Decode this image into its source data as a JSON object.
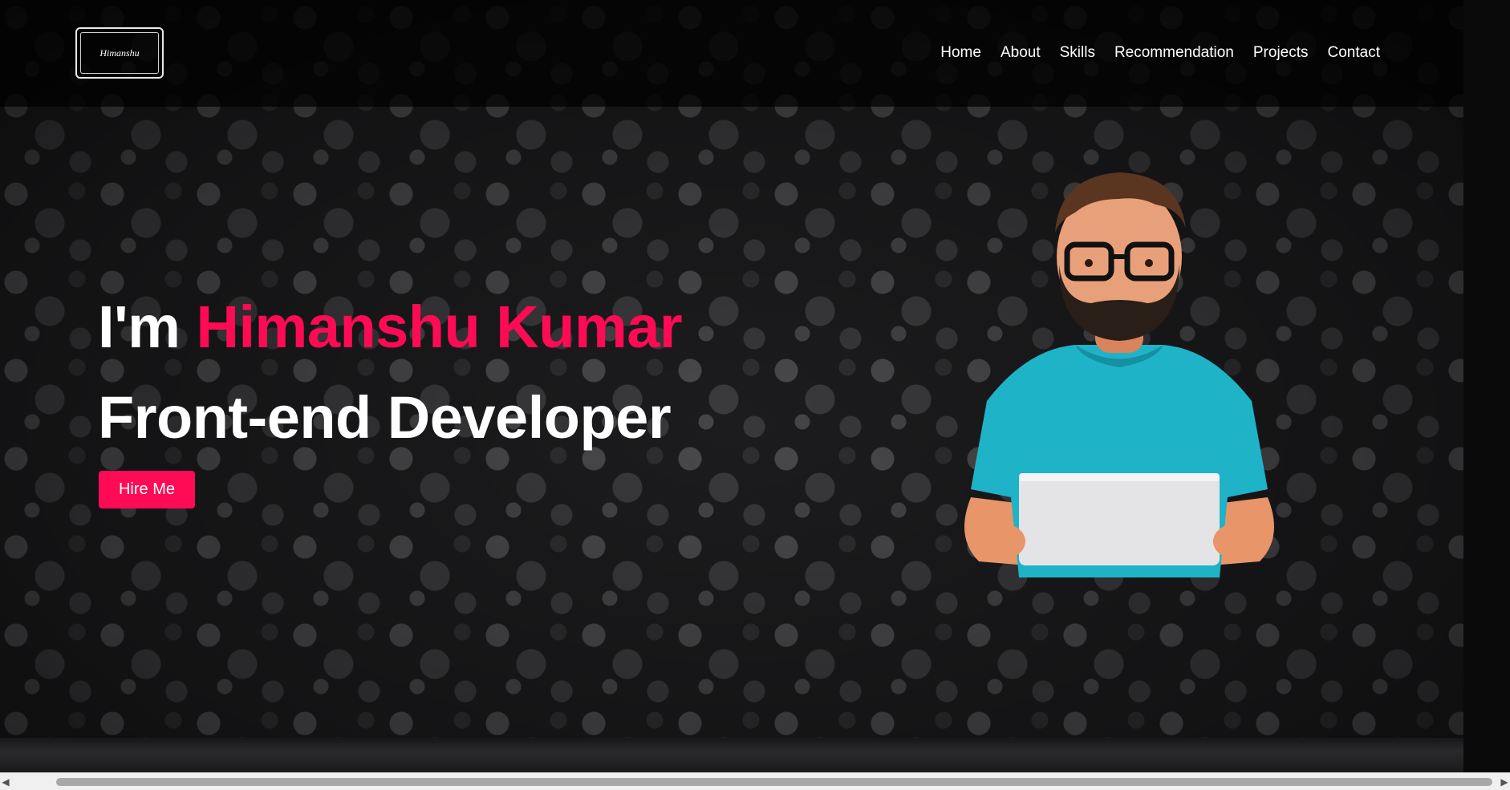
{
  "header": {
    "logo_text": "Himanshu",
    "nav": [
      "Home",
      "About",
      "Skills",
      "Recommendation",
      "Projects",
      "Contact"
    ]
  },
  "hero": {
    "greeting": "I'm",
    "name": "Himanshu Kumar",
    "role": "Front-end Developer",
    "cta_label": "Hire Me"
  },
  "colors": {
    "accent": "#ff0a54",
    "text": "#ffffff",
    "background": "#0b0b0c"
  },
  "icons": {
    "scroll_left": "left-arrow-icon",
    "scroll_right": "right-arrow-icon"
  }
}
